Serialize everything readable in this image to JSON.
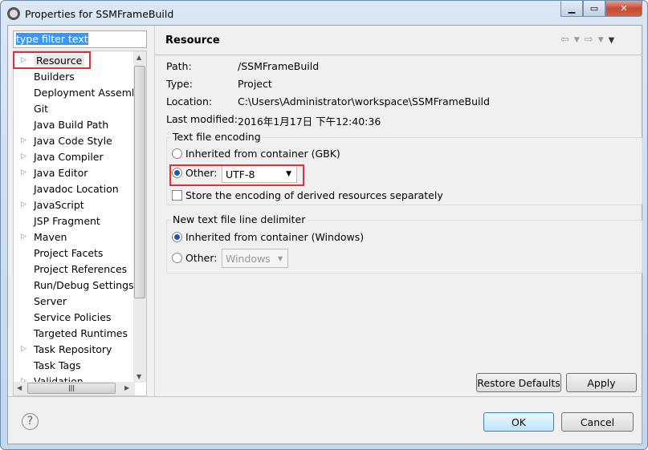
{
  "window": {
    "title": "Properties for SSMFrameBuild",
    "minimize_icon": "minimize-icon",
    "maximize_icon": "maximize-icon",
    "close_icon": "close-icon"
  },
  "sidebar": {
    "filter_value": "type filter text",
    "items": [
      {
        "label": "Resource",
        "expandable": true,
        "selected": true
      },
      {
        "label": "Builders",
        "expandable": false
      },
      {
        "label": "Deployment Assembly",
        "expandable": false
      },
      {
        "label": "Git",
        "expandable": false
      },
      {
        "label": "Java Build Path",
        "expandable": false
      },
      {
        "label": "Java Code Style",
        "expandable": true
      },
      {
        "label": "Java Compiler",
        "expandable": true
      },
      {
        "label": "Java Editor",
        "expandable": true
      },
      {
        "label": "Javadoc Location",
        "expandable": false
      },
      {
        "label": "JavaScript",
        "expandable": true
      },
      {
        "label": "JSP Fragment",
        "expandable": false
      },
      {
        "label": "Maven",
        "expandable": true
      },
      {
        "label": "Project Facets",
        "expandable": false
      },
      {
        "label": "Project References",
        "expandable": false
      },
      {
        "label": "Run/Debug Settings",
        "expandable": false
      },
      {
        "label": "Server",
        "expandable": false
      },
      {
        "label": "Service Policies",
        "expandable": false
      },
      {
        "label": "Targeted Runtimes",
        "expandable": false
      },
      {
        "label": "Task Repository",
        "expandable": true
      },
      {
        "label": "Task Tags",
        "expandable": false
      },
      {
        "label": "Validation",
        "expandable": true
      }
    ]
  },
  "main": {
    "title": "Resource",
    "info": [
      {
        "label": "Path:",
        "value": "/SSMFrameBuild"
      },
      {
        "label": "Type:",
        "value": "Project"
      },
      {
        "label": "Location:",
        "value": "C:\\Users\\Administrator\\workspace\\SSMFrameBuild"
      },
      {
        "label": "Last modified:",
        "value": "2016年1月17日 下午12:40:36"
      }
    ],
    "encoding": {
      "group_label": "Text file encoding",
      "inherited_label": "Inherited from container (GBK)",
      "other_label": "Other:",
      "other_value": "UTF-8",
      "selected": "other",
      "store_label": "Store the encoding of derived resources separately",
      "store_checked": false
    },
    "delimiter": {
      "group_label": "New text file line delimiter",
      "inherited_label": "Inherited from container (Windows)",
      "other_label": "Other:",
      "other_value": "Windows",
      "selected": "inherited"
    },
    "restore_label": "Restore Defaults",
    "apply_label": "Apply"
  },
  "footer": {
    "ok_label": "OK",
    "cancel_label": "Cancel",
    "help_icon": "help-icon"
  },
  "colors": {
    "highlight": "#e0303a",
    "selection": "#3399ff"
  }
}
